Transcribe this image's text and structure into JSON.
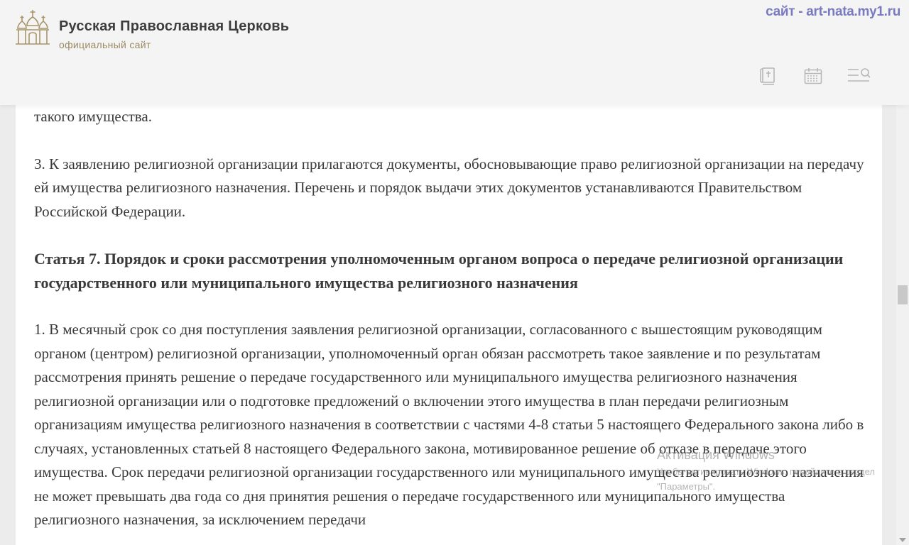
{
  "header": {
    "site_title": "Русская Православная Церковь",
    "site_subtitle": "официальный сайт",
    "watermark_text": "сайт  - art-nata.my1.ru",
    "buttons": [
      {
        "icon": "bible-icon"
      },
      {
        "icon": "calendar-icon"
      },
      {
        "icon": "menu-search-icon"
      }
    ]
  },
  "article": {
    "fragment_top": "такого имущества.",
    "para_3": "3. К заявлению религиозной организации прилагаются документы, обосновывающие право религиозной организации на передачу ей имущества религиозного назначения. Перечень и порядок выдачи этих документов устанавливаются Правительством Российской Федерации.",
    "heading_7": "Статья 7. Порядок и сроки рассмотрения уполномоченным органом вопроса о передаче религиозной организации государственного или муниципального имущества религиозного назначения",
    "para_7_1": "1. В месячный срок со дня поступления заявления религиозной организации, согласованного с вышестоящим руководящим органом (центром) религиозной организации, уполномоченный орган обязан рассмотреть такое заявление и по результатам рассмотрения принять решение о передаче государственного или муниципального имущества религиозного назначения религиозной организации или о подготовке предложений о включении этого имущества в план передачи религиозным организациям имущества религиозного назначения в соответствии с частями 4-8 статьи 5 настоящего Федерального закона либо в случаях, установленных статьей 8 настоящего Федерального закона, мотивированное решение об отказе в передаче этого имущества. Срок передачи религиозной организации государственного или муниципального имущества религиозного назначения не может превышать два года со дня принятия решения о передаче государственного или муниципального имущества религиозного назначения, за исключением передачи"
  },
  "windows_activation": {
    "title": "Активация Windows",
    "subtitle": "Чтобы активировать Windows, перейдите в раздел \"Параметры\"."
  },
  "colors": {
    "logo_gold": "#a89468",
    "icon_gray": "#b7b7b7",
    "watermark_blue": "#7a7ac0"
  }
}
